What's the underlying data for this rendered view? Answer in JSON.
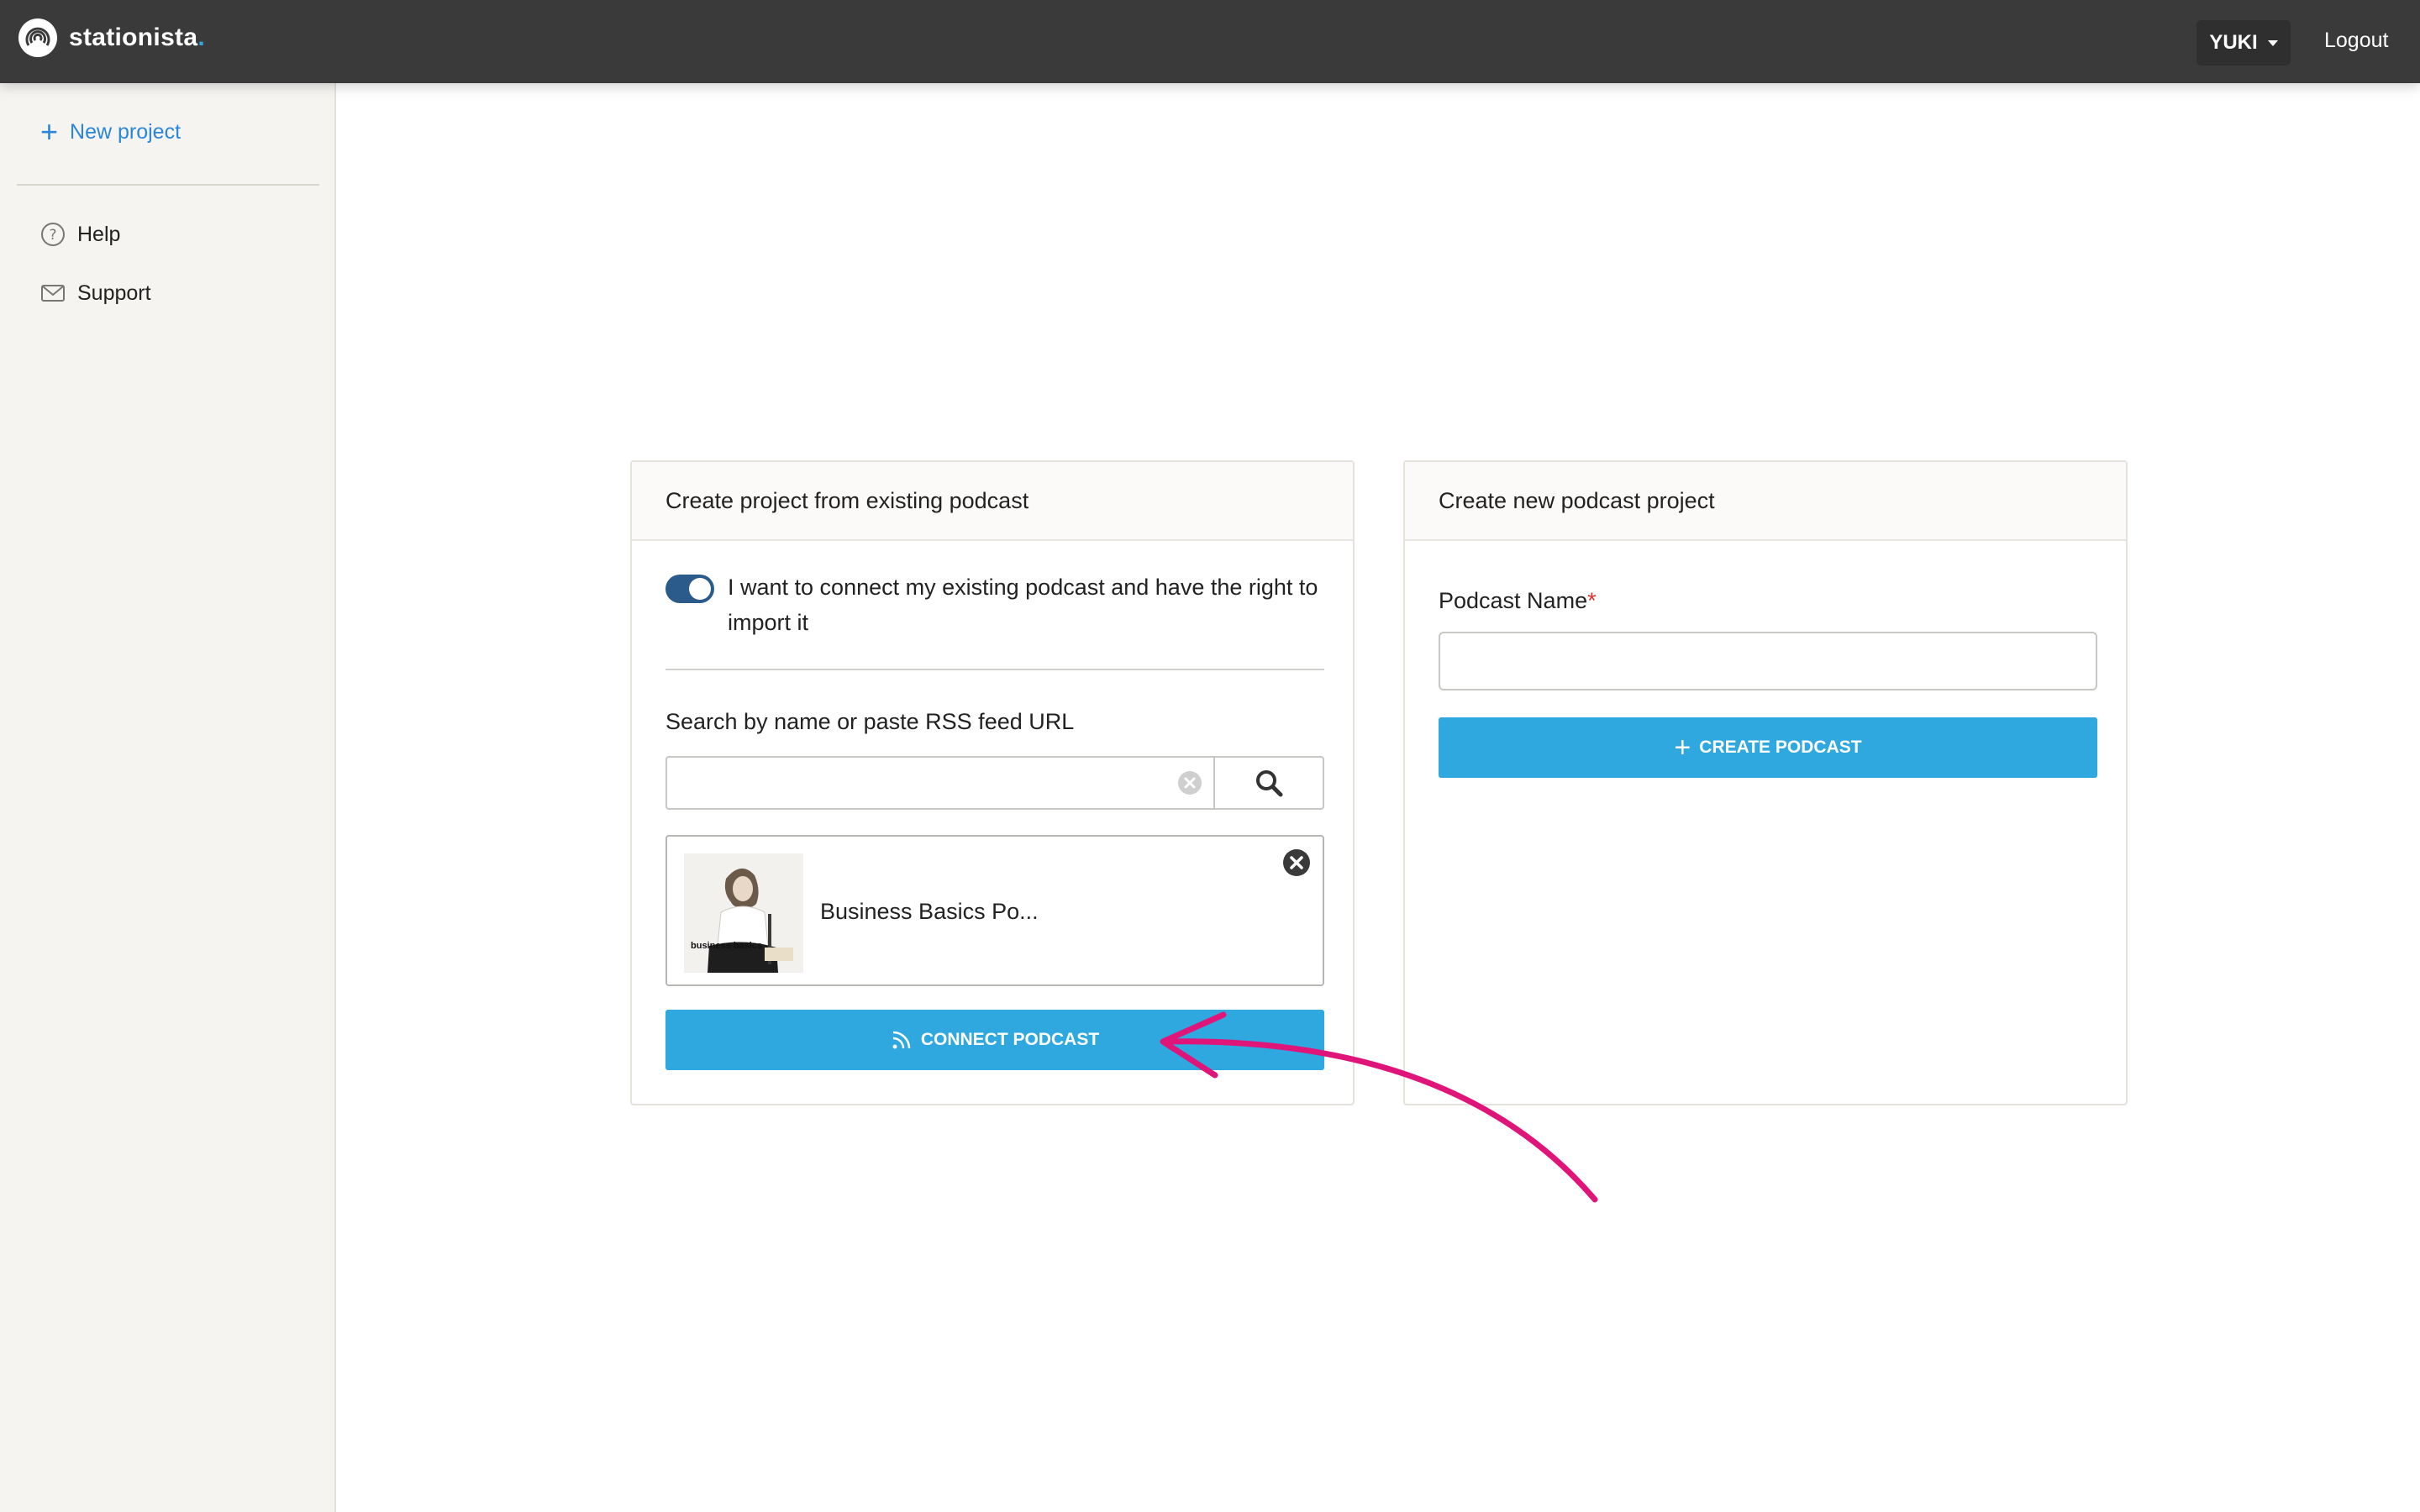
{
  "header": {
    "brand_name": "stationista",
    "brand_dot": ".",
    "user_label": "YUKI",
    "logout_label": "Logout"
  },
  "sidebar": {
    "new_project_label": "New project",
    "items": [
      {
        "label": "Help",
        "icon": "help-circle-icon"
      },
      {
        "label": "Support",
        "icon": "envelope-icon"
      }
    ]
  },
  "existing_card": {
    "title": "Create project from existing podcast",
    "toggle_on": true,
    "toggle_label": "I want to connect my existing podcast and have the right to import it",
    "search_label": "Search by name or paste RSS feed URL",
    "search_value": "",
    "result_title": "Business Basics Po...",
    "result_thumb_text": "business basics",
    "connect_label": "CONNECT PODCAST"
  },
  "new_card": {
    "title": "Create new podcast project",
    "name_label": "Podcast Name",
    "required_mark": "*",
    "name_value": "",
    "create_label": "CREATE PODCAST"
  },
  "colors": {
    "topbar": "#3a3a3a",
    "accent": "#2ea8df",
    "toggle": "#2a5b8a",
    "annotation_arrow": "#e0157a"
  }
}
